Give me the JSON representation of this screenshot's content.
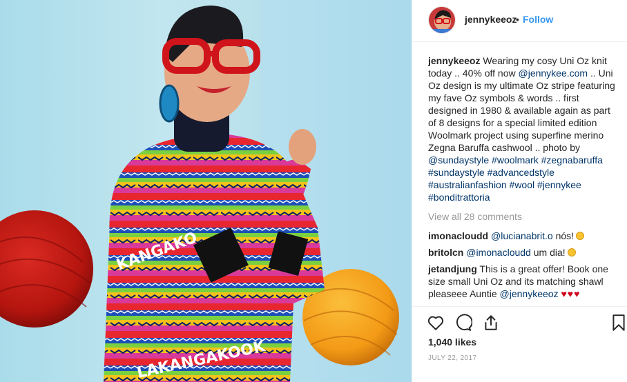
{
  "post": {
    "username": "jennykeeoz",
    "separator": "•",
    "follow_label": "Follow",
    "caption_user": "jennykeeoz",
    "caption_parts": {
      "p1": " Wearing my cosy Uni Oz knit today .. 40% off now ",
      "link_site": "@jennykee.com",
      "p2": " .. Uni Oz design is my ultimate Oz stripe featuring my fave Oz symbols & words .. first designed in 1980 & available again as part of 8 designs for a special limited edition Woolmark project using superfine merino Zegna Baruffa cashwool .. photo by ",
      "link_photographer": "@sundaystyle",
      "tags": [
        "#woolmark",
        "#zegnabaruffa",
        "#sundaystyle",
        "#advancedstyle",
        "#australianfashion",
        "#wool",
        "#jennykee",
        "#bonditrattoria"
      ]
    },
    "view_all_comments": "View all 28 comments",
    "comments": [
      {
        "user": "imonacloudd",
        "mention": "@lucianabrit.o",
        "text": " nós!",
        "emoji": "smiling-face"
      },
      {
        "user": "britolcn",
        "mention": "@imonacloudd",
        "text": " um dia!",
        "emoji": "smiling-face"
      },
      {
        "user": "jetandjung",
        "text_a": " This is a great offer! Book one size small Uni Oz and its matching shawl pleaseee Auntie ",
        "mention": "@jennykeeoz",
        "hearts": "♥♥♥"
      }
    ],
    "likes": "1,040 likes",
    "date": "JULY 22, 2017",
    "icons": {
      "like": "heart-outline-icon",
      "comment": "comment-bubble-icon",
      "share": "share-icon",
      "save": "bookmark-icon"
    },
    "colors": {
      "link": "#003569",
      "follow": "#3897f0",
      "muted": "#999999",
      "heart": "#d0021b"
    }
  }
}
